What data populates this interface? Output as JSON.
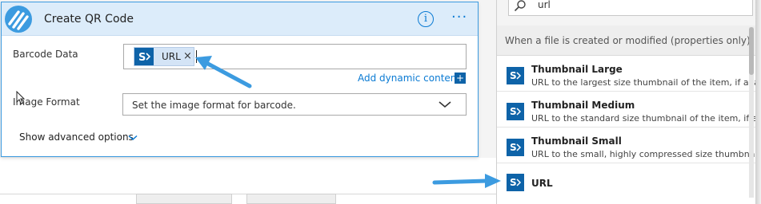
{
  "card": {
    "title": "Create QR Code",
    "info_icon": "info-icon",
    "more_icon": "more-icon"
  },
  "barcode": {
    "label": "Barcode Data",
    "token_label": "URL",
    "token_close": "×",
    "add_dynamic": "Add dynamic content",
    "add_dynamic_plus": "+"
  },
  "image_format": {
    "label": "Image Format",
    "placeholder": "Set the image format for barcode."
  },
  "advanced": {
    "label": "Show advanced options"
  },
  "dynamic_pane": {
    "search_value": "url",
    "group_header": "When a file is created or modified (properties only)",
    "items": [
      {
        "title": "Thumbnail Large",
        "desc": "URL to the largest size thumbnail of the item, if availa"
      },
      {
        "title": "Thumbnail Medium",
        "desc": "URL to the standard size thumbnail of the item, if avai"
      },
      {
        "title": "Thumbnail Small",
        "desc": "URL to the small, highly compressed size thumbnail o"
      },
      {
        "title": "URL",
        "desc": ""
      }
    ]
  },
  "colors": {
    "accent": "#0a7ad3",
    "header_bg": "#dcecfa",
    "sharepoint_blue": "#0e63a8",
    "callout_arrow": "#3c9be0"
  }
}
